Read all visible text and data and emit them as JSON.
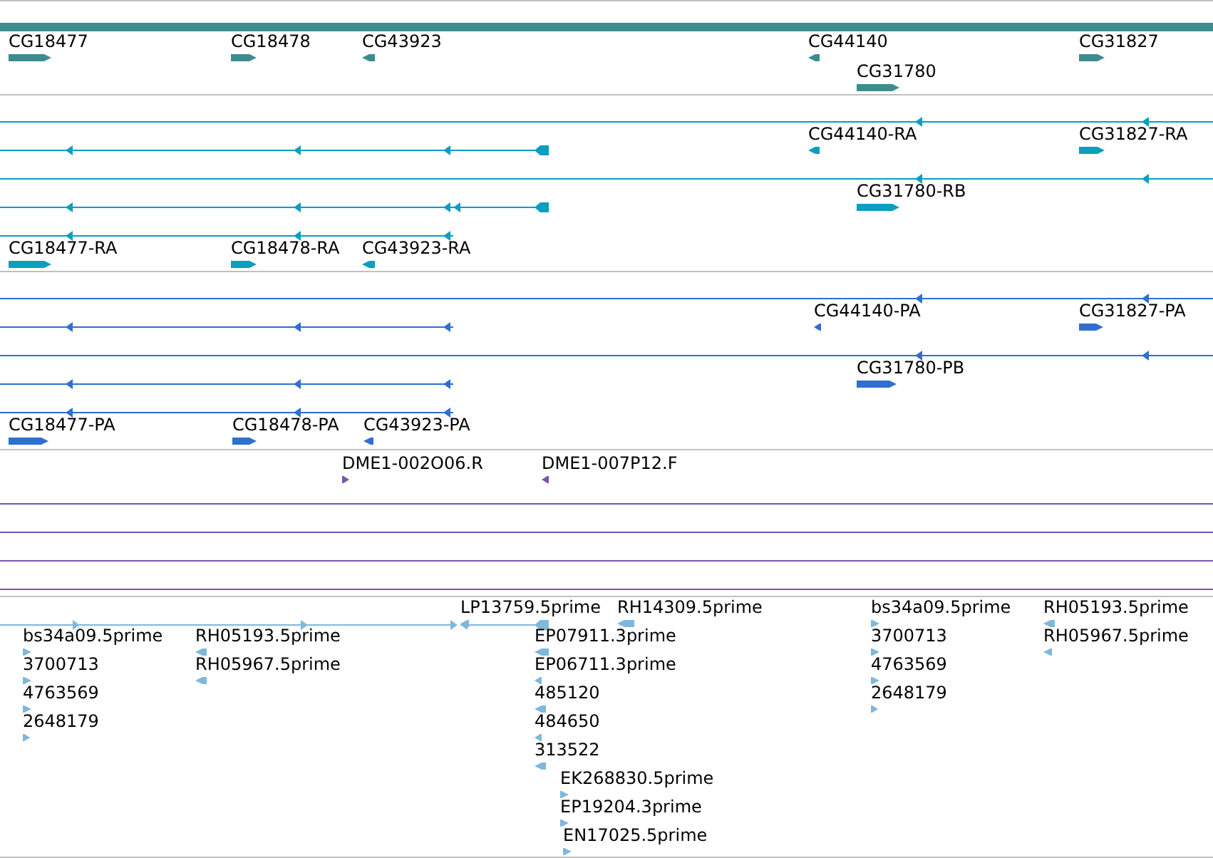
{
  "tracks": [
    {
      "kind": "gene",
      "features": [
        {
          "label": "CG18477",
          "kind": "forward"
        },
        {
          "label": "CG18478",
          "kind": "forward"
        },
        {
          "label": "CG43923",
          "kind": "reverse"
        },
        {
          "label": "CG44140",
          "kind": "reverse"
        },
        {
          "label": "CG31780",
          "kind": "forward"
        },
        {
          "label": "CG31827",
          "kind": "forward"
        }
      ]
    },
    {
      "kind": "transcript",
      "features": [
        {
          "label": "CG44140-RA",
          "kind": "reverse"
        },
        {
          "label": "CG31827-RA",
          "kind": "forward"
        },
        {
          "label": "CG31780-RB",
          "kind": "forward"
        },
        {
          "label": "CG18477-RA",
          "kind": "forward"
        },
        {
          "label": "CG18478-RA",
          "kind": "forward"
        },
        {
          "label": "CG43923-RA",
          "kind": "reverse"
        }
      ]
    },
    {
      "kind": "protein",
      "features": [
        {
          "label": "CG44140-PA",
          "kind": "reverse"
        },
        {
          "label": "CG31827-PA",
          "kind": "forward"
        },
        {
          "label": "CG31780-PB",
          "kind": "forward"
        },
        {
          "label": "CG18477-PA",
          "kind": "forward"
        },
        {
          "label": "CG18478-PA",
          "kind": "forward"
        },
        {
          "label": "CG43923-PA",
          "kind": "reverse"
        }
      ]
    },
    {
      "kind": "clone",
      "features": [
        {
          "label": "DME1-002O06.R",
          "kind": "forward"
        },
        {
          "label": "DME1-007P12.F",
          "kind": "reverse"
        }
      ]
    },
    {
      "kind": "est",
      "features": [
        {
          "label": "bs34a09.5prime",
          "kind": "forward"
        },
        {
          "label": "3700713",
          "kind": "forward"
        },
        {
          "label": "4763569",
          "kind": "forward"
        },
        {
          "label": "2648179",
          "kind": "forward"
        },
        {
          "label": "RH05193.5prime",
          "kind": "reverse"
        },
        {
          "label": "RH05967.5prime",
          "kind": "reverse"
        },
        {
          "label": "LP13759.5prime",
          "kind": "reverse"
        },
        {
          "label": "EP07911.3prime",
          "kind": "reverse"
        },
        {
          "label": "EP06711.3prime",
          "kind": "reverse"
        },
        {
          "label": "485120",
          "kind": "reverse"
        },
        {
          "label": "484650",
          "kind": "reverse"
        },
        {
          "label": "313522",
          "kind": "reverse"
        },
        {
          "label": "EK268830.5prime",
          "kind": "forward"
        },
        {
          "label": "EP19204.3prime",
          "kind": "forward"
        },
        {
          "label": "EN17025.5prime",
          "kind": "forward"
        },
        {
          "label": "RH14309.5prime",
          "kind": "reverse"
        },
        {
          "label": "bs34a09.5prime",
          "kind": "forward"
        },
        {
          "label": "3700713",
          "kind": "forward"
        },
        {
          "label": "4763569",
          "kind": "forward"
        },
        {
          "label": "2648179",
          "kind": "forward"
        },
        {
          "label": "RH05193.5prime",
          "kind": "reverse"
        },
        {
          "label": "RH05967.5prime",
          "kind": "reverse"
        }
      ]
    }
  ]
}
